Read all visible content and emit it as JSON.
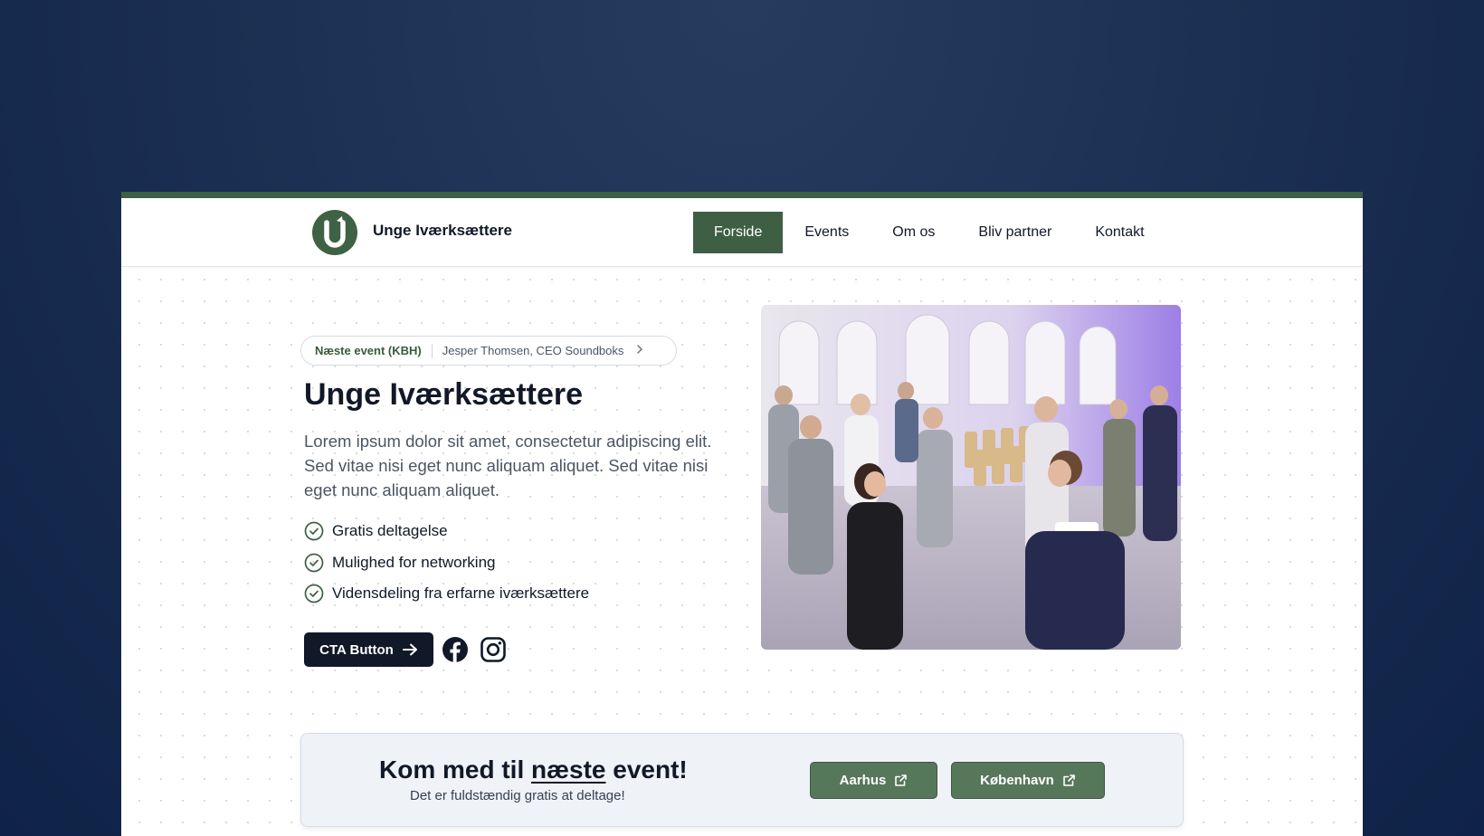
{
  "brand": {
    "name": "Unge Iværksættere",
    "logo_letter": "U"
  },
  "nav": {
    "items": [
      {
        "label": "Forside",
        "active": true
      },
      {
        "label": "Events",
        "active": false
      },
      {
        "label": "Om os",
        "active": false
      },
      {
        "label": "Bliv partner",
        "active": false
      },
      {
        "label": "Kontakt",
        "active": false
      }
    ]
  },
  "hero": {
    "pill": {
      "tag": "Næste event (KBH)",
      "text": "Jesper Thomsen, CEO Soundboks",
      "icon": "chevron-right-icon"
    },
    "title": "Unge Iværksættere",
    "text": "Lorem ipsum dolor sit amet, consectetur adipiscing elit. Sed vitae nisi eget nunc aliquam aliquet. Sed vitae nisi eget nunc aliquam aliquet.",
    "features": [
      "Gratis deltagelse",
      "Mulighed for networking",
      "Vidensdeling fra erfarne iværksættere"
    ],
    "cta_label": "CTA Button",
    "socials": [
      "facebook-icon",
      "instagram-icon"
    ]
  },
  "banner": {
    "title_before": "Kom med til ",
    "title_highlight": "næste",
    "title_after": " event!",
    "subtitle": "Det er fuldstændig gratis at deltage!",
    "buttons": [
      {
        "label": "Aarhus",
        "icon": "external-link-icon"
      },
      {
        "label": "København",
        "icon": "external-link-icon"
      }
    ]
  },
  "colors": {
    "accent": "#3e5f43",
    "button_green": "#57775b",
    "dark": "#111827",
    "background": "#1c3053"
  }
}
